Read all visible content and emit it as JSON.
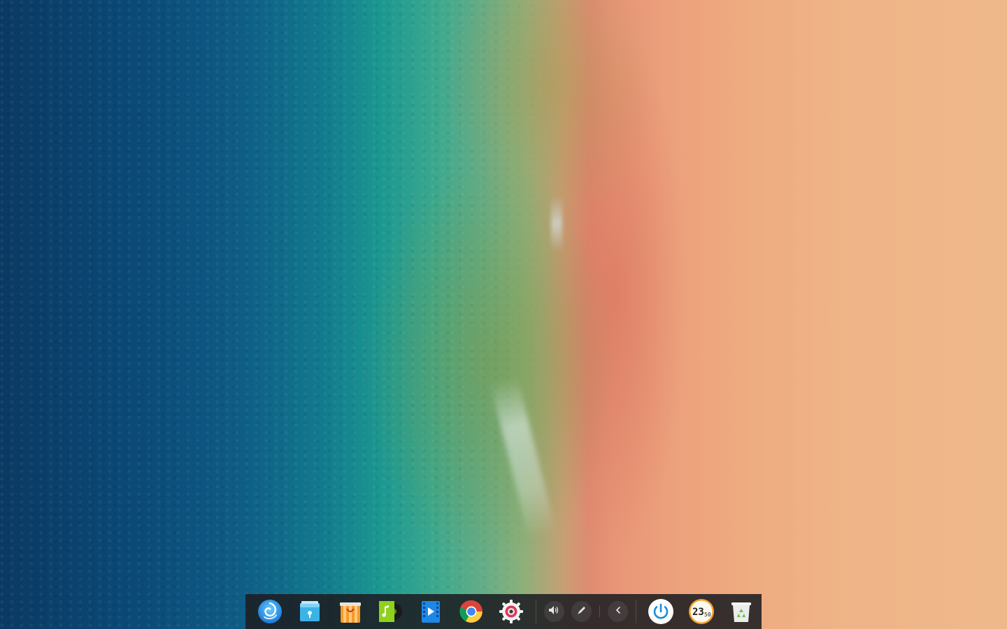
{
  "wallpaper": {
    "name": "aerial-beach-wallpaper",
    "colors": {
      "deep_ocean": "#0a3a63",
      "turquoise": "#1c9891",
      "shallow_green": "#8eb07a",
      "sand_red": "#df8b72",
      "sand": "#efb88b"
    }
  },
  "dock": {
    "background": "#1c1e22",
    "apps": [
      {
        "name": "launcher",
        "icon": "deepin-launcher-icon"
      },
      {
        "name": "file-manager",
        "icon": "file-manager-icon"
      },
      {
        "name": "app-store",
        "icon": "app-store-icon"
      },
      {
        "name": "music",
        "icon": "music-icon"
      },
      {
        "name": "movie",
        "icon": "movie-icon"
      },
      {
        "name": "chrome",
        "icon": "chrome-icon"
      },
      {
        "name": "control-center",
        "icon": "settings-gear-icon"
      }
    ],
    "tray": [
      {
        "name": "volume",
        "icon": "volume-icon"
      },
      {
        "name": "pen",
        "icon": "pen-icon"
      },
      {
        "name": "expand",
        "icon": "chevron-left-icon"
      }
    ],
    "clock": {
      "hours": "23",
      "minutes": "50"
    },
    "extras": [
      {
        "name": "shutdown",
        "icon": "power-icon"
      },
      {
        "name": "trash",
        "icon": "trash-icon"
      }
    ]
  }
}
